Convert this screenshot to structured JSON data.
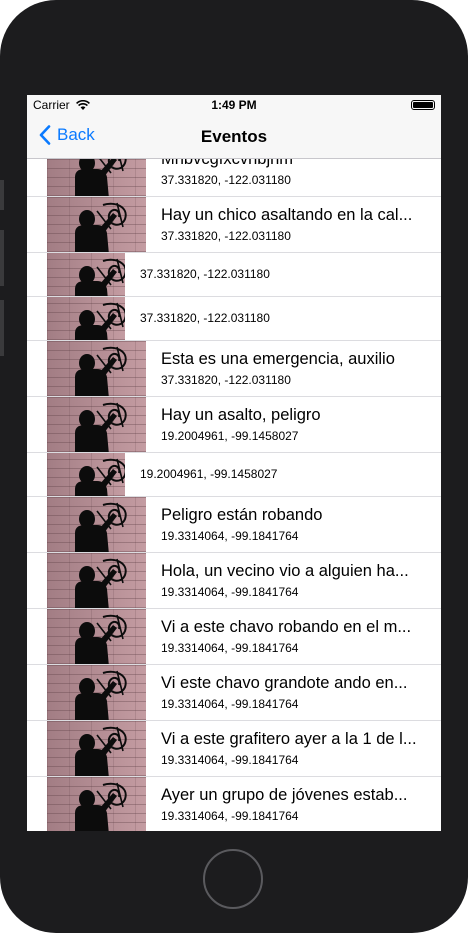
{
  "status_bar": {
    "carrier": "Carrier",
    "wifi_icon": "wifi-icon",
    "time": "1:49 PM",
    "battery_icon": "battery-full-icon"
  },
  "nav": {
    "back_label": "Back",
    "back_icon": "chevron-left-icon",
    "title": "Eventos"
  },
  "colors": {
    "accent": "#0a7aff",
    "nav_background": "#f7f7f7",
    "device_frame": "#1c1c1e"
  },
  "events": [
    {
      "title": "Mnbvcgfxcvnbjnm",
      "coords": "37.331820, -122.031180",
      "thumb_icon": "graffiti-photo-thumbnail"
    },
    {
      "title": "Hay un chico asaltando en la cal...",
      "coords": "37.331820, -122.031180",
      "thumb_icon": "graffiti-photo-thumbnail"
    },
    {
      "title": "",
      "coords": "37.331820, -122.031180",
      "thumb_icon": "graffiti-photo-thumbnail"
    },
    {
      "title": "",
      "coords": "37.331820, -122.031180",
      "thumb_icon": "graffiti-photo-thumbnail"
    },
    {
      "title": "Esta es una emergencia, auxilio",
      "coords": "37.331820, -122.031180",
      "thumb_icon": "graffiti-photo-thumbnail"
    },
    {
      "title": "Hay un asalto, peligro",
      "coords": "19.2004961, -99.1458027",
      "thumb_icon": "graffiti-photo-thumbnail"
    },
    {
      "title": "",
      "coords": "19.2004961, -99.1458027",
      "thumb_icon": "graffiti-photo-thumbnail"
    },
    {
      "title": "Peligro están robando",
      "coords": "19.3314064, -99.1841764",
      "thumb_icon": "graffiti-photo-thumbnail"
    },
    {
      "title": "Hola, un vecino vio a alguien ha...",
      "coords": "19.3314064, -99.1841764",
      "thumb_icon": "graffiti-photo-thumbnail"
    },
    {
      "title": "Vi a este chavo robando en el m...",
      "coords": "19.3314064, -99.1841764",
      "thumb_icon": "graffiti-photo-thumbnail"
    },
    {
      "title": "Vi este chavo grandote ando en...",
      "coords": "19.3314064, -99.1841764",
      "thumb_icon": "graffiti-photo-thumbnail"
    },
    {
      "title": "Vi a este grafitero ayer a la 1 de l...",
      "coords": "19.3314064, -99.1841764",
      "thumb_icon": "graffiti-photo-thumbnail"
    },
    {
      "title": "Ayer un grupo de jóvenes estab...",
      "coords": "19.3314064, -99.1841764",
      "thumb_icon": "graffiti-photo-thumbnail"
    }
  ]
}
